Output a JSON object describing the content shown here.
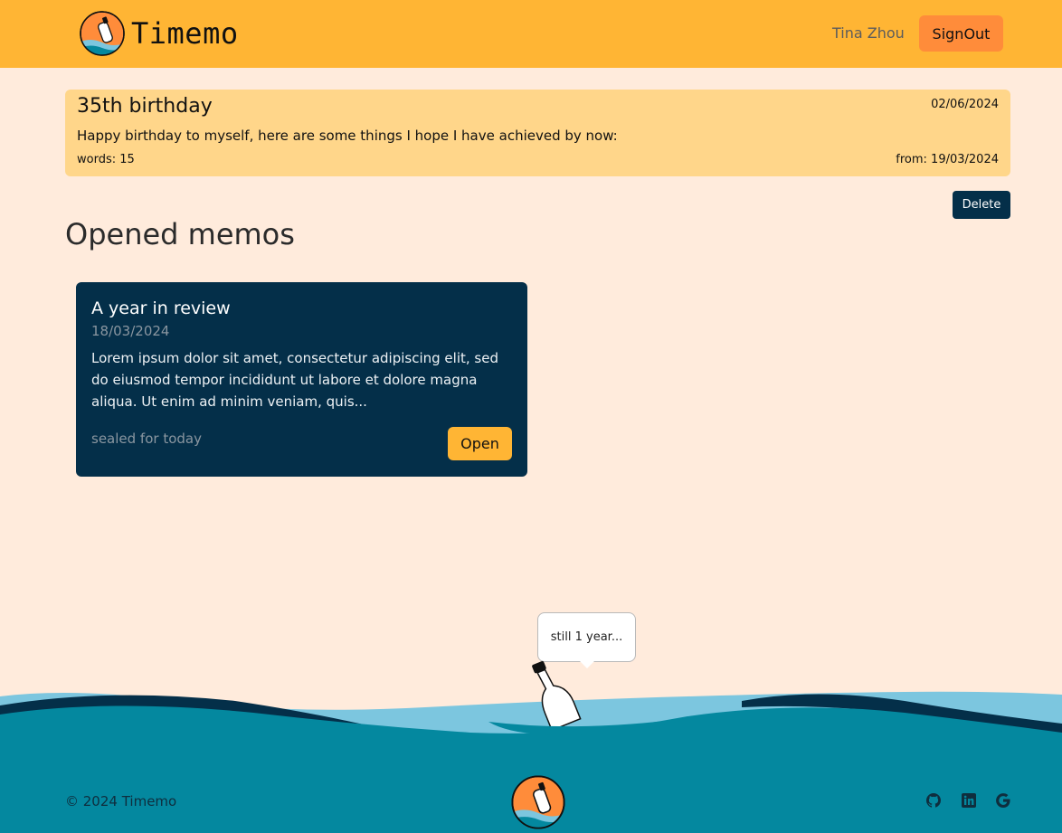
{
  "app": {
    "brand_name": "Timemo",
    "logo_icon": "message-in-a-bottle-logo"
  },
  "navbar": {
    "user_name": "Tina Zhou",
    "signout_label": "SignOut"
  },
  "featured_memo": {
    "title": "35th birthday",
    "date": "02/06/2024",
    "body": "Happy birthday to myself, here are some things I hope I have achieved by now:",
    "words": "words: 15",
    "from": "from: 19/03/2024",
    "delete_label": "Delete"
  },
  "opened_memos": {
    "heading": "Opened memos",
    "items": [
      {
        "title": "A year in review",
        "date": "18/03/2024",
        "excerpt": "Lorem ipsum dolor sit amet, consectetur adipiscing elit, sed do eiusmod tempor incididunt ut labore et dolore magna aliqua. Ut enim ad minim veniam, quis...",
        "status": "sealed for today",
        "open_label": "Open"
      }
    ]
  },
  "mascot": {
    "bubble_text": "still 1 year...",
    "icon": "bottle-icon"
  },
  "footer": {
    "copyright": "© 2024 Timemo",
    "social_icons": [
      "github-icon",
      "linkedin-icon",
      "google-icon"
    ]
  },
  "colors": {
    "navbar_bg": "#ffb534",
    "page_bg": "#ffebdc",
    "featured_card_bg": "#ffd68a",
    "dark_navy": "#042f49",
    "signout_bg": "#ff8c3a",
    "sea_teal": "#04889f",
    "sea_light": "#7cc6df"
  }
}
